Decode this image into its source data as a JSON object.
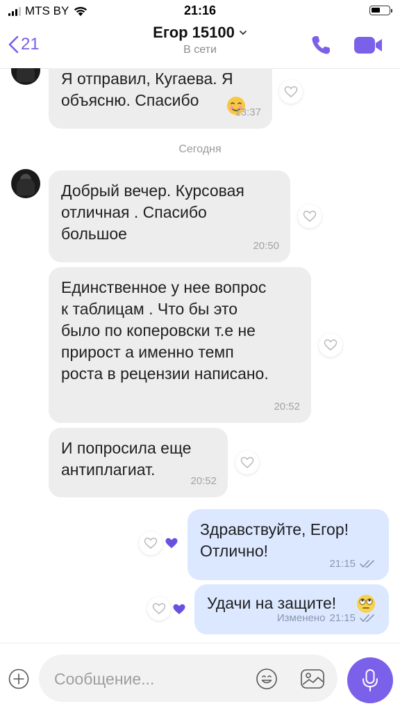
{
  "status_bar": {
    "carrier": "MTS BY",
    "time": "21:16"
  },
  "header": {
    "back_count": "21",
    "contact_name": "Егор 15100",
    "status": "В сети"
  },
  "date_separator": "Сегодня",
  "messages": [
    {
      "direction": "in",
      "text": "Я отправил, Кугаева. Я\nобъясню. Спасибо",
      "emoji": "smiling-face-emoji",
      "time": "13:37"
    },
    {
      "direction": "in",
      "text": "Добрый вечер. Курсовая\nотличная . Спасибо\nбольшое",
      "time": "20:50"
    },
    {
      "direction": "in",
      "text": "Единственное у нее вопрос\nк таблицам . Что бы это\nбыло по коперовски т.е не\nприрост а именно темп\nроста в рецензии написано.",
      "time": "20:52"
    },
    {
      "direction": "in",
      "text": "И попросила еще\nантиплагиат.",
      "time": "20:52"
    },
    {
      "direction": "out",
      "text": "Здравствуйте, Егор!\nОтлично!",
      "time": "21:15"
    },
    {
      "direction": "out",
      "text": "Удачи на защите!",
      "emoji": "rolling-eyes-emoji",
      "edited": "Изменено",
      "time": "21:15"
    }
  ],
  "input": {
    "placeholder": "Сообщение..."
  },
  "colors": {
    "accent": "#7b61e9",
    "incoming_bubble": "#ededed",
    "outgoing_bubble": "#dbe8ff"
  }
}
